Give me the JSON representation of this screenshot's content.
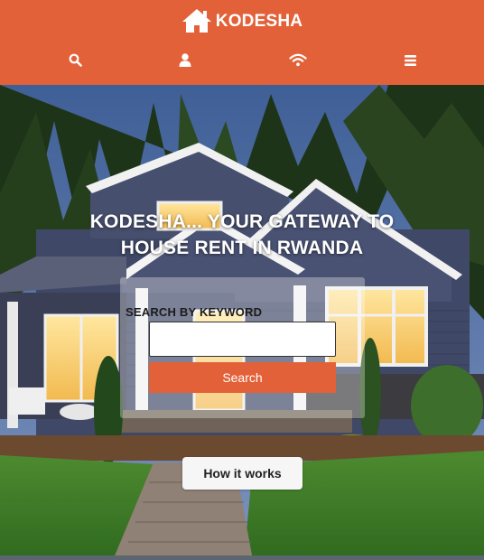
{
  "brand": {
    "name": "KODESHA",
    "icon": "house-icon"
  },
  "nav": {
    "items": [
      {
        "name": "search",
        "icon": "search-icon"
      },
      {
        "name": "user",
        "icon": "user-icon"
      },
      {
        "name": "wifi",
        "icon": "wifi-icon"
      },
      {
        "name": "menu",
        "icon": "hamburger-menu-icon"
      }
    ]
  },
  "hero": {
    "title": "KODESHA... YOUR GATEWAY TO HOUSE RENT IN RWANDA"
  },
  "search": {
    "label": "SEARCH BY KEYWORD",
    "value": "",
    "placeholder": "",
    "button_label": "Search"
  },
  "how_it_works": {
    "label": "How it works"
  },
  "colors": {
    "accent": "#e36138",
    "header_text": "#ffffff",
    "button_light": "#f6f6f6"
  }
}
